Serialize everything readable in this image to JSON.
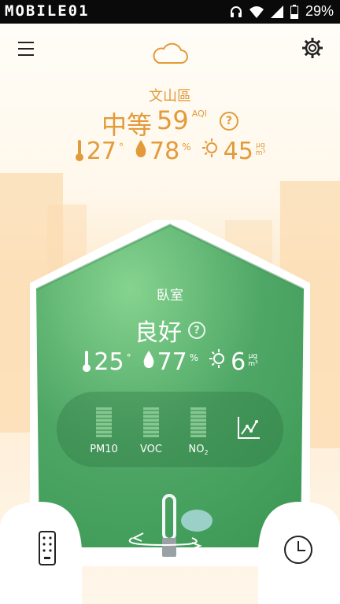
{
  "status_bar": {
    "brand": "MOBILE01",
    "battery": "29%"
  },
  "header": {
    "menu_icon": "hamburger-menu-icon",
    "weather_icon": "cloud-icon",
    "settings_icon": "gear-icon"
  },
  "outdoor": {
    "location": "文山區",
    "aqi_level": "中等",
    "aqi_value": "59",
    "aqi_unit": "AQI",
    "temperature": "27",
    "temperature_unit": "°",
    "humidity": "78",
    "humidity_unit": "%",
    "pm": "45",
    "pm_unit_top": "μg",
    "pm_unit_bottom": "m³",
    "help": "?"
  },
  "indoor": {
    "room": "臥室",
    "status": "良好",
    "temperature": "25",
    "temperature_unit": "°",
    "humidity": "77",
    "humidity_unit": "%",
    "pm": "6",
    "pm_unit_top": "μg",
    "pm_unit_bottom": "m³",
    "help": "?"
  },
  "sensors": [
    {
      "label": "PM10",
      "level": 0.2
    },
    {
      "label": "VOC",
      "level": 0.2
    },
    {
      "label": "NO",
      "sub": "2",
      "level": 0.2
    }
  ],
  "colors": {
    "accent_orange": "#e39a3a",
    "house_green": "#4aa662",
    "house_light": "#7dcf88"
  }
}
